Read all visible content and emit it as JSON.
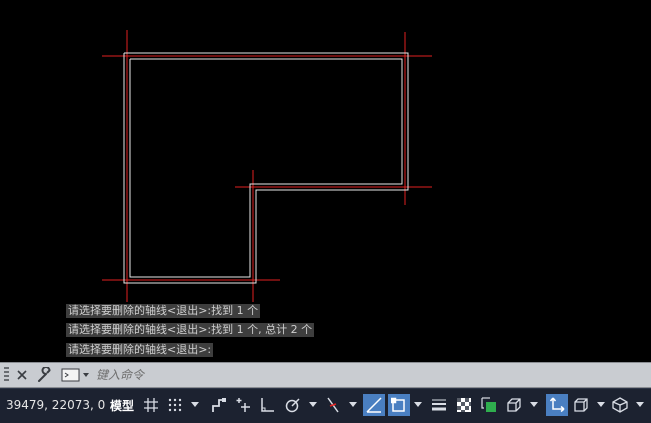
{
  "drawing": {
    "wall_color": "#e8e8e8",
    "axis_color": "#e0211f"
  },
  "history": [
    "请选择要删除的轴线<退出>:找到 1 个",
    "请选择要删除的轴线<退出>:找到 1 个, 总计 2 个",
    "请选择要删除的轴线<退出>:"
  ],
  "command_line": {
    "placeholder": "键入命令",
    "close_icon": "close-icon",
    "customize_icon": "wrench-icon",
    "recent_icon": "command-prompt-icon"
  },
  "status_bar": {
    "coordinates": "39479, 22073, 0",
    "model_label": "模型",
    "icons": [
      "grid-icon",
      "snap-icon",
      "infer-constraints-icon",
      "dynamic-input-icon",
      "ortho-icon",
      "polar-icon",
      "isodraft-icon",
      "osnap-track-icon",
      "osnap-icon",
      "lineweight-icon",
      "transparency-icon",
      "selection-cycling-icon",
      "3d-osnap-icon",
      "dynamic-ucs-icon",
      "selection-filter-icon",
      "gizmo-icon"
    ]
  }
}
